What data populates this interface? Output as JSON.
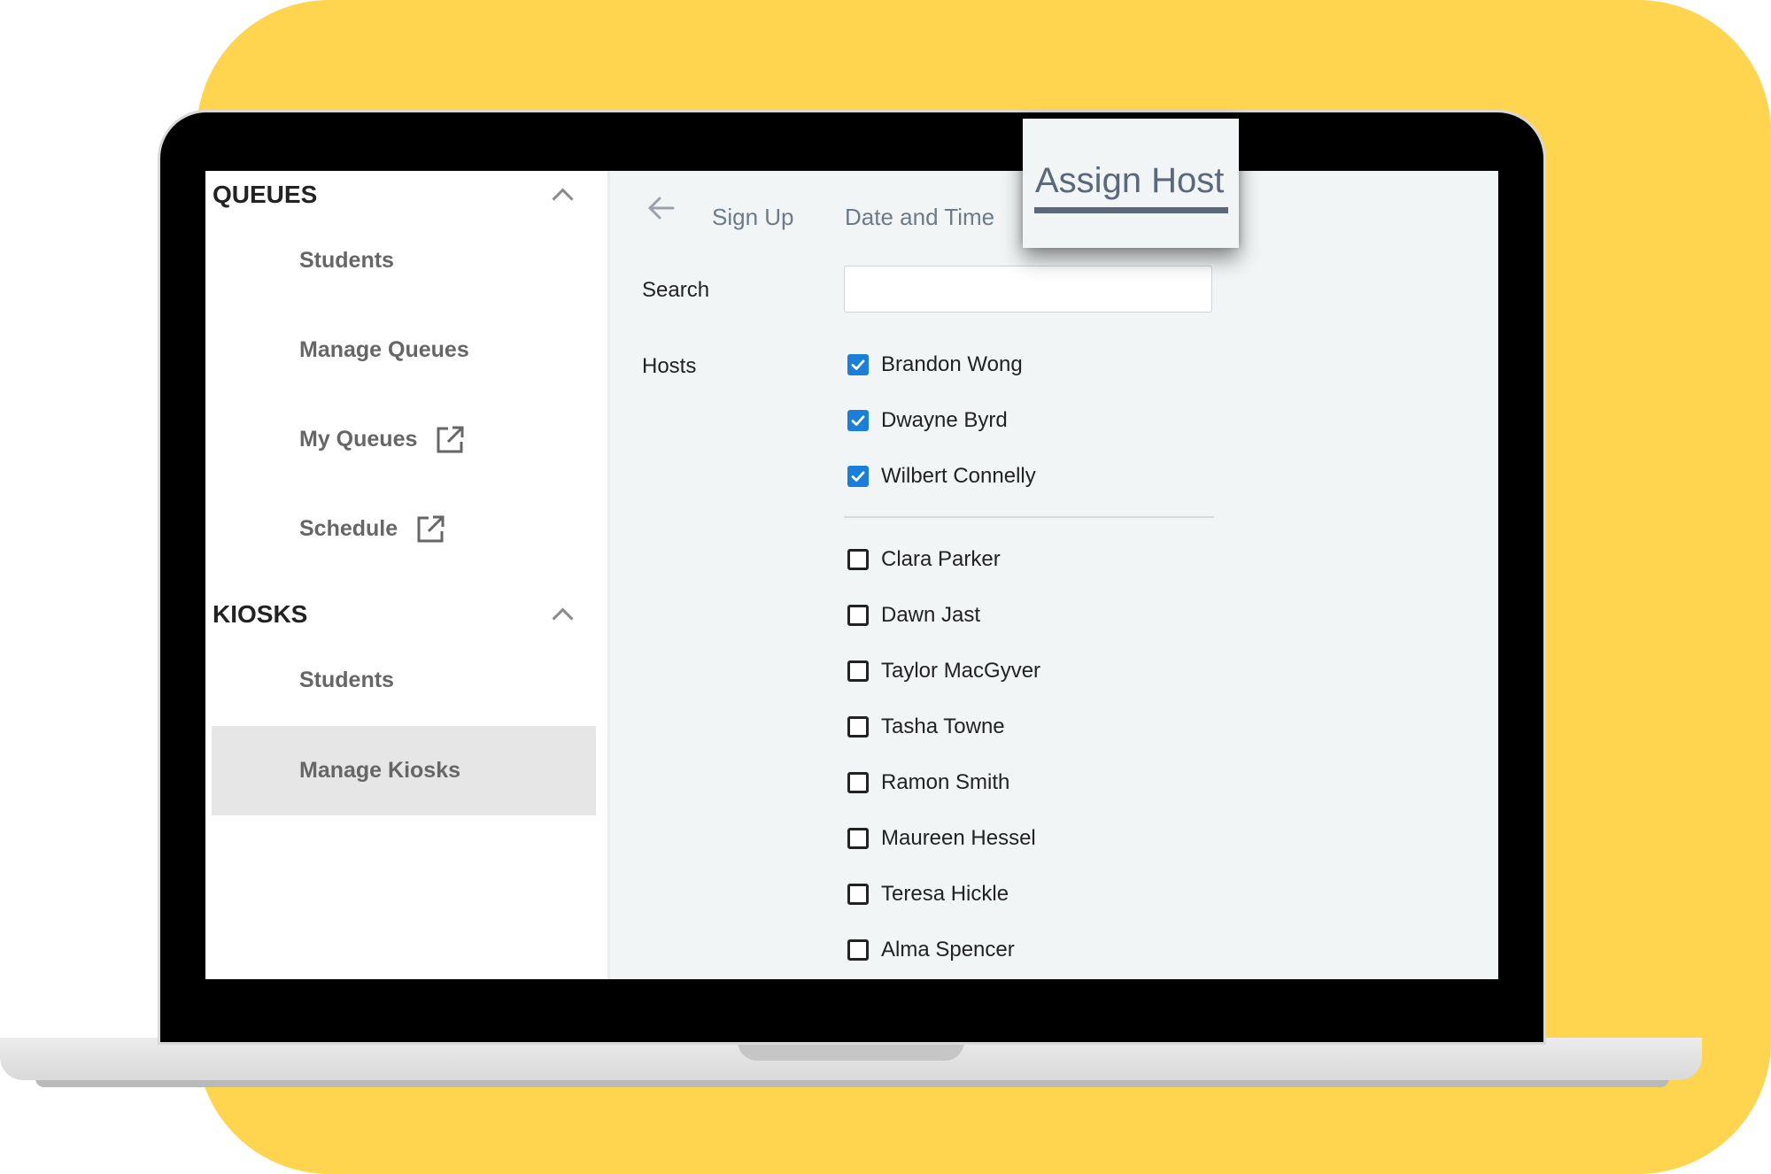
{
  "sidebar": {
    "sections": [
      {
        "title": "QUEUES",
        "items": [
          {
            "label": "Students",
            "external": false,
            "active": false
          },
          {
            "label": "Manage Queues",
            "external": false,
            "active": false
          },
          {
            "label": "My Queues",
            "external": true,
            "active": false
          },
          {
            "label": "Schedule",
            "external": true,
            "active": false
          }
        ]
      },
      {
        "title": "KIOSKS",
        "items": [
          {
            "label": "Students",
            "external": false,
            "active": false
          },
          {
            "label": "Manage Kiosks",
            "external": false,
            "active": true
          }
        ]
      }
    ]
  },
  "steps": {
    "tabs": [
      "Sign Up",
      "Date and Time",
      "Assign Host"
    ],
    "active": "Assign Host"
  },
  "form": {
    "search_label": "Search",
    "search_value": "",
    "hosts_label": "Hosts",
    "hosts_selected": [
      "Brandon Wong",
      "Dwayne Byrd",
      "Wilbert Connelly"
    ],
    "hosts_unselected": [
      "Clara Parker",
      "Dawn Jast",
      "Taylor MacGyver",
      "Tasha Towne",
      "Ramon Smith",
      "Maureen Hessel",
      "Teresa Hickle",
      "Alma Spencer"
    ]
  },
  "colors": {
    "background_accent": "#FFD44F",
    "checkbox_checked": "#1A7FDB",
    "active_tab": "#5A6878"
  },
  "icons": [
    "chevron-up-icon",
    "external-link-icon",
    "back-arrow-icon",
    "checkmark-icon"
  ]
}
